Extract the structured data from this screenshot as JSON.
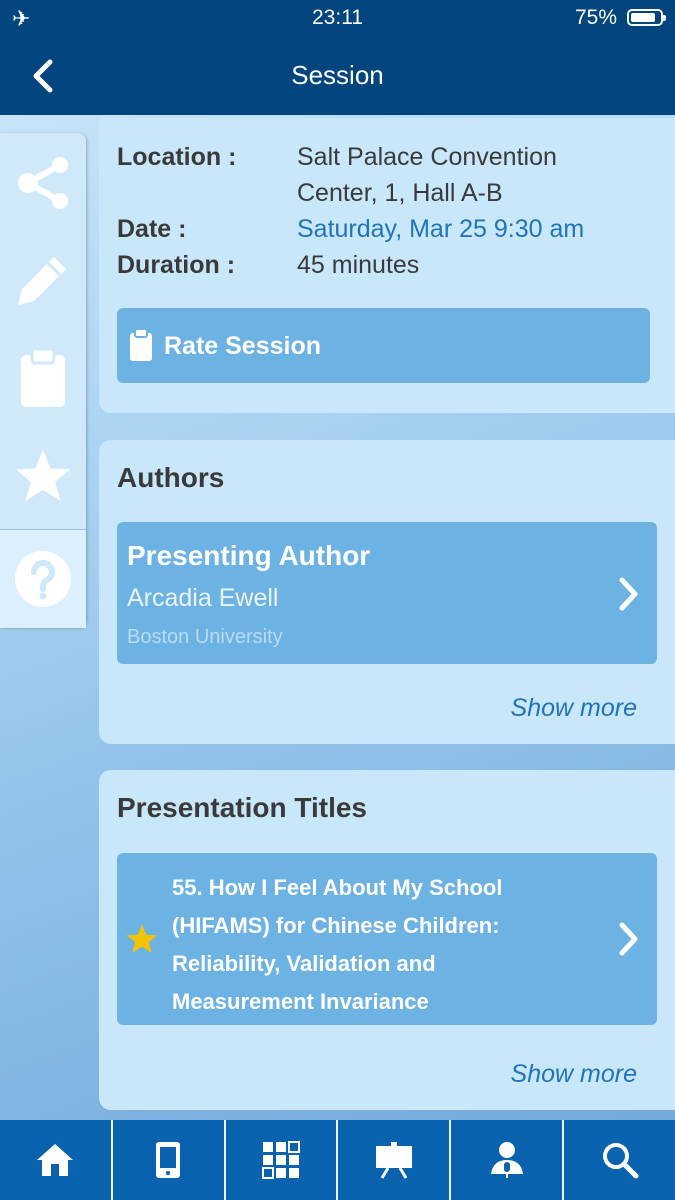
{
  "status": {
    "time": "23:11",
    "battery": "75%",
    "airplane_icon": "airplane-icon",
    "battery_level": 0.75
  },
  "nav": {
    "title": "Session",
    "back_icon": "chevron-left-icon"
  },
  "sidebar": {
    "items": [
      "share-icon",
      "pencil-icon",
      "clipboard-icon",
      "star-icon",
      "help-icon"
    ]
  },
  "session": {
    "location_label": "Location :",
    "location_line1": "Salt Palace Convention",
    "location_line2": "Center, 1, Hall A-B",
    "date_label": "Date :",
    "date_value": "Saturday, Mar 25 9:30 am",
    "duration_label": "Duration :",
    "duration_value": "45 minutes",
    "rate_label": "Rate Session"
  },
  "authors": {
    "title": "Authors",
    "role": "Presenting Author",
    "name": "Arcadia Ewell",
    "affiliation": "Boston University",
    "show_more": "Show more"
  },
  "presentations": {
    "title": "Presentation Titles",
    "line1": "55. How I Feel About My School",
    "line2": "(HIFAMS) for Chinese Children:",
    "line3": "Reliability, Validation and",
    "line4": "Measurement Invariance",
    "show_more": "Show more"
  },
  "tabbar": {
    "items": [
      "home-icon",
      "mobile-device-icon",
      "qr-code-icon",
      "presentation-easel-icon",
      "speaker-icon",
      "search-icon"
    ]
  },
  "colors": {
    "navy": "#00457d",
    "tab_blue": "#0962ad",
    "button_blue": "#6cb2e3",
    "link_blue": "#1f74bb",
    "star_yellow": "#f6c300"
  }
}
